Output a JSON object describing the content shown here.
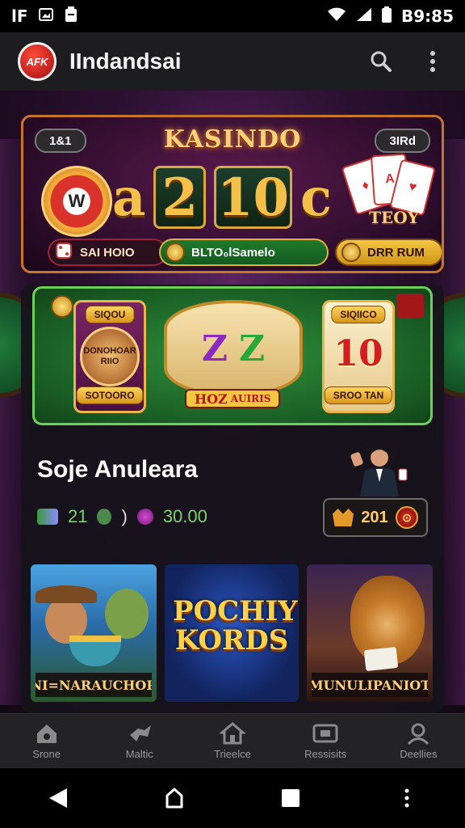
{
  "status_bar": {
    "left_icons": [
      "signal-text-icon",
      "image-icon",
      "clipboard-icon"
    ],
    "left_text": "lF",
    "time": "B9:85"
  },
  "app_bar": {
    "logo_text": "AFK",
    "title": "IIndandsai"
  },
  "hero": {
    "title": "KASINDO",
    "left_pill": "1&1",
    "right_pill": "3IRd",
    "chip_text": "W",
    "big_a": "a",
    "big_digit": "2",
    "big_10": "10",
    "big_c": "c",
    "sub": "TEOY",
    "btn1": "SAI HOIO",
    "btn2": "BLTO₀lSamelo",
    "btn3": "DRR RUM"
  },
  "slots": {
    "left_tag_top": "SIQOU",
    "left_wheel": "DONOHOAR RIIO",
    "left_tag_bottom": "SOTOORO",
    "reel1": "Z",
    "reel2": "Z",
    "mid_label": "HOZ",
    "mid_sub": "AUIRIS",
    "right_tag_top": "SIQIICO",
    "right_num": "10",
    "right_tag_bottom": "SROO TAN"
  },
  "section": {
    "title": "Soje Anuleara",
    "stat1": "21",
    "stat2": ")",
    "stat3": "30.00",
    "balance": "201"
  },
  "tiles": [
    {
      "label": "NI=NARAUCHOR"
    },
    {
      "title": "POCHIY KORDS"
    },
    {
      "label": "MUNULIPANIOT"
    }
  ],
  "bottom_nav": [
    {
      "icon": "home-icon",
      "label": "Srone"
    },
    {
      "icon": "hashtag-icon",
      "label": "Maltic"
    },
    {
      "icon": "house-icon",
      "label": "Trieelce"
    },
    {
      "icon": "tv-icon",
      "label": "Ressisits"
    },
    {
      "icon": "profile-icon",
      "label": "Deellies"
    }
  ],
  "colors": {
    "hero_border": "#c6762b",
    "slots_border": "#6fcf5a",
    "accent_gold": "#ffd27a"
  }
}
